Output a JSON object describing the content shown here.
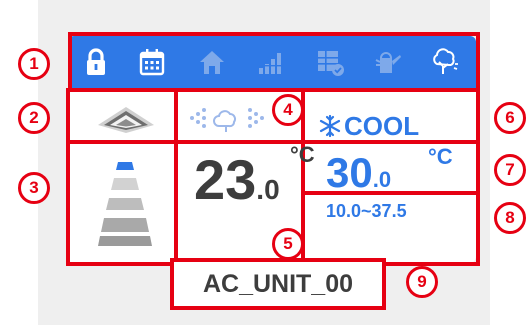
{
  "toolbar": {
    "icons": [
      "lock-icon",
      "calendar-icon",
      "home-icon",
      "signal-icon",
      "schedule-check-icon",
      "watering-can-icon",
      "tree-icon"
    ]
  },
  "colors": {
    "accent": "#2f79e6",
    "highlight": "#e60012",
    "text_dark": "#3d3d3d",
    "icon_muted": "#7ea9ea"
  },
  "callouts": [
    "1",
    "2",
    "3",
    "4",
    "5",
    "6",
    "7",
    "8",
    "9"
  ],
  "indoor": {
    "temp_int": "23",
    "temp_dec": ".0",
    "unit": "°C"
  },
  "mode": {
    "icon": "snowflake-icon",
    "label": "COOL"
  },
  "setpoint": {
    "temp_int": "30",
    "temp_dec": ".0",
    "unit": "°C",
    "range": "10.0~37.5"
  },
  "unit_name": "AC_UNIT_00"
}
